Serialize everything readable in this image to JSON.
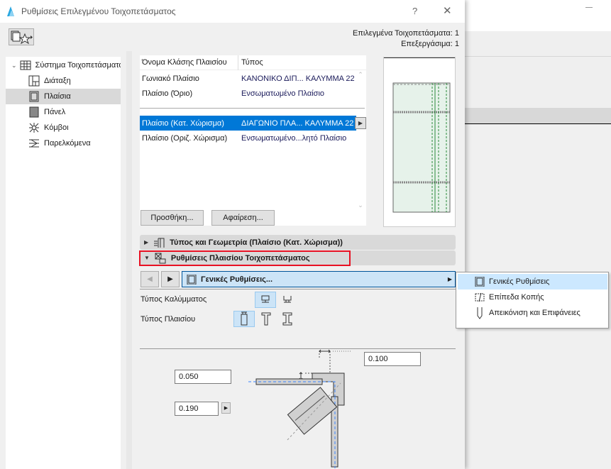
{
  "dialog": {
    "title": "Ρυθμίσεις Επιλεγμένου Τοιχοπετάσματος",
    "help": "?",
    "close": "✕"
  },
  "header": {
    "selected": "Επιλεγμένα Τοιχοπετάσματα: 1",
    "editable": "Επεξεργάσιμα: 1"
  },
  "tree": {
    "root": "Σύστημα Τοιχοπετάσματος",
    "items": [
      {
        "label": "Διάταξη",
        "icon": "layout-icon"
      },
      {
        "label": "Πλαίσια",
        "icon": "frame-icon",
        "selected": true
      },
      {
        "label": "Πάνελ",
        "icon": "panel-icon"
      },
      {
        "label": "Κόμβοι",
        "icon": "junction-icon"
      },
      {
        "label": "Παρελκόμενα",
        "icon": "accessory-icon"
      }
    ]
  },
  "list": {
    "columns": [
      "Όνομα Κλάσης Πλαισίου",
      "Τύπος"
    ],
    "rows": [
      [
        "Γωνιακό Πλαίσιο",
        "ΚΑΝΟΝΙΚΟ ΔΙΠ... ΚΑΛΥΜΜΑ 22"
      ],
      [
        "Πλαίσιο (Όριο)",
        "Ενσωματωμένο Πλαίσιο"
      ]
    ],
    "rows2": [
      [
        "Πλαίσιο (Κατ. Χώρισμα)",
        "ΔΙΑΓΩΝΙΟ ΠΛΑ... ΚΑΛΥΜΜΑ 22"
      ],
      [
        "Πλαίσιο (Οριζ. Χώρισμα)",
        "Ενσωματωμένο...λητό Πλαίσιο"
      ]
    ],
    "add": "Προσθήκη...",
    "remove": "Αφαίρεση..."
  },
  "sections": {
    "type_geometry": "Τύπος και Γεωμετρία (Πλαίσιο (Κατ. Χώρισμα))",
    "frame_settings": "Ρυθμίσεις Πλαισίου Τοιχοπετάσματος"
  },
  "page_selector": {
    "value": "Γενικές Ρυθμίσεις..."
  },
  "menu": {
    "items": [
      "Γενικές Ρυθμίσεις",
      "Επίπεδα Κοπής",
      "Απεικόνιση και Επιφάνειες"
    ]
  },
  "settings": {
    "cap_type": "Τύπος Καλύμματος",
    "frame_type": "Τύπος Πλαισίου",
    "width": "0.100",
    "offset": "0.050",
    "depth": "0.190"
  },
  "colors": {
    "selection": "#0078d7",
    "highlight_border": "#e81123",
    "menu_hover": "#cce8ff"
  }
}
